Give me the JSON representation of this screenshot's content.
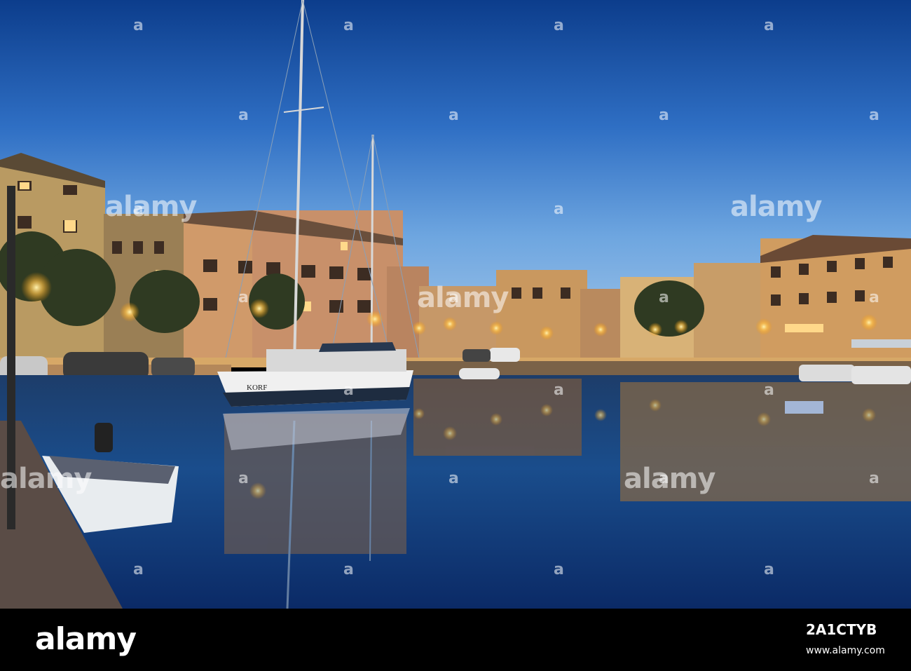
{
  "watermark": {
    "logo": "alamy",
    "mark": "a"
  },
  "boat_name": "KORF",
  "footer": {
    "logo": "alamy",
    "image_id": "2A1CTYB",
    "url": "www.alamy.com"
  }
}
